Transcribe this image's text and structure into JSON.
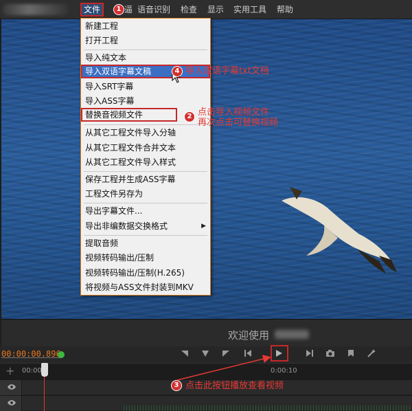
{
  "menubar": {
    "items": [
      "文件",
      "语音识别",
      "检查",
      "显示",
      "实用工具",
      "帮助"
    ],
    "partial_item": "逼"
  },
  "file_menu": {
    "items": [
      "新建工程",
      "打开工程",
      "导入纯文本",
      "导入双语字幕文稿",
      "导入SRT字幕",
      "导入ASS字幕",
      "替换音视频文件",
      "从其它工程文件导入分轴",
      "从其它工程文件合并文本",
      "从其它工程文件导入样式",
      "保存工程并生成ASS字幕",
      "工程文件另存为",
      "导出字幕文件...",
      "导出非编数据交换格式",
      "提取音频",
      "视频转码输出/压制",
      "视频转码输出/压制(H.265)",
      "将视频与ASS文件封装到MKV"
    ]
  },
  "annotations": {
    "badge1": "1",
    "badge2": "2",
    "badge3": "3",
    "badge4": "4",
    "note4": "导入双语字幕txt文档",
    "note2_line1": "点击导入视频文件",
    "note2_line2": "再次点击可替换视频",
    "note3": "点击此按钮播放查看视频"
  },
  "welcome": {
    "text": "欢迎使用"
  },
  "transport": {
    "timecode": "00:00:00.896"
  },
  "timeline": {
    "ticks": [
      "00:00",
      "0:00:10"
    ]
  },
  "colors": {
    "accent_red": "#c62828",
    "timecode_orange": "#e8781e",
    "highlight_blue": "#3b6fc3",
    "status_green": "#3db83d"
  }
}
